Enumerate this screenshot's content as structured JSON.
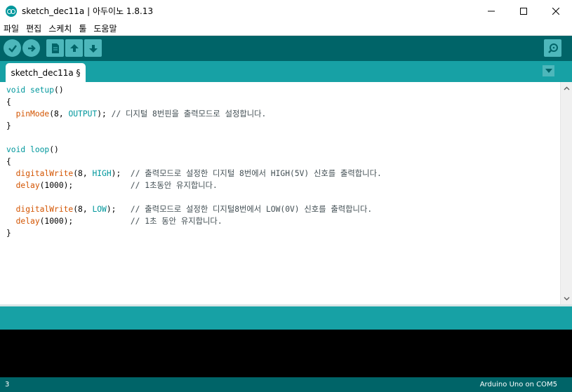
{
  "window": {
    "title": "sketch_dec11a | 아두이노 1.8.13",
    "minimize_glyph": "—",
    "maximize_glyph": "☐",
    "close_glyph": "✕"
  },
  "menu": [
    "파일",
    "편집",
    "스케치",
    "툴",
    "도움말"
  ],
  "toolbar": {
    "buttons": [
      {
        "name": "verify-icon"
      },
      {
        "name": "upload-icon"
      },
      {
        "name": "new-icon"
      },
      {
        "name": "open-icon"
      },
      {
        "name": "save-icon"
      },
      {
        "name": "serial-monitor-icon"
      }
    ]
  },
  "tab": {
    "label": "sketch_dec11a §"
  },
  "code": {
    "lines": [
      [
        {
          "t": "void",
          "c": "kw"
        },
        {
          "t": " ",
          "c": ""
        },
        {
          "t": "setup",
          "c": "kw"
        },
        {
          "t": "()",
          "c": ""
        }
      ],
      [
        {
          "t": "{",
          "c": ""
        }
      ],
      [
        {
          "t": "  ",
          "c": ""
        },
        {
          "t": "pinMode",
          "c": "fn"
        },
        {
          "t": "(8, ",
          "c": ""
        },
        {
          "t": "OUTPUT",
          "c": "const"
        },
        {
          "t": "); ",
          "c": ""
        },
        {
          "t": "// 디지털 8번핀을 출력모드로 설정합니다.",
          "c": "cm"
        }
      ],
      [
        {
          "t": "}",
          "c": ""
        }
      ],
      [
        {
          "t": "",
          "c": ""
        }
      ],
      [
        {
          "t": "void",
          "c": "kw"
        },
        {
          "t": " ",
          "c": ""
        },
        {
          "t": "loop",
          "c": "kw"
        },
        {
          "t": "()",
          "c": ""
        }
      ],
      [
        {
          "t": "{",
          "c": ""
        }
      ],
      [
        {
          "t": "  ",
          "c": ""
        },
        {
          "t": "digitalWrite",
          "c": "fn"
        },
        {
          "t": "(8, ",
          "c": ""
        },
        {
          "t": "HIGH",
          "c": "const"
        },
        {
          "t": ");  ",
          "c": ""
        },
        {
          "t": "// 출력모드로 설정한 디지털 8번에서 HIGH(5V) 신호를 출력합니다.",
          "c": "cm"
        }
      ],
      [
        {
          "t": "  ",
          "c": ""
        },
        {
          "t": "delay",
          "c": "fn"
        },
        {
          "t": "(1000);            ",
          "c": ""
        },
        {
          "t": "// 1초동안 유지합니다.",
          "c": "cm"
        }
      ],
      [
        {
          "t": "",
          "c": ""
        }
      ],
      [
        {
          "t": "  ",
          "c": ""
        },
        {
          "t": "digitalWrite",
          "c": "fn"
        },
        {
          "t": "(8, ",
          "c": ""
        },
        {
          "t": "LOW",
          "c": "const"
        },
        {
          "t": ");   ",
          "c": ""
        },
        {
          "t": "// 출력모드로 설정한 디지털8번에서 LOW(0V) 신호를 출력합니다.",
          "c": "cm"
        }
      ],
      [
        {
          "t": "  ",
          "c": ""
        },
        {
          "t": "delay",
          "c": "fn"
        },
        {
          "t": "(1000);            ",
          "c": ""
        },
        {
          "t": "// 1초 동안 유지합니다.",
          "c": "cm"
        }
      ],
      [
        {
          "t": "}",
          "c": ""
        }
      ]
    ]
  },
  "status": {
    "line_number": "3",
    "board": "Arduino Uno on COM5"
  },
  "colors": {
    "toolbar": "#006468",
    "tabstrip": "#17a1a5",
    "button": "#4db7bb",
    "keyword": "#00979c",
    "function": "#d35400"
  }
}
